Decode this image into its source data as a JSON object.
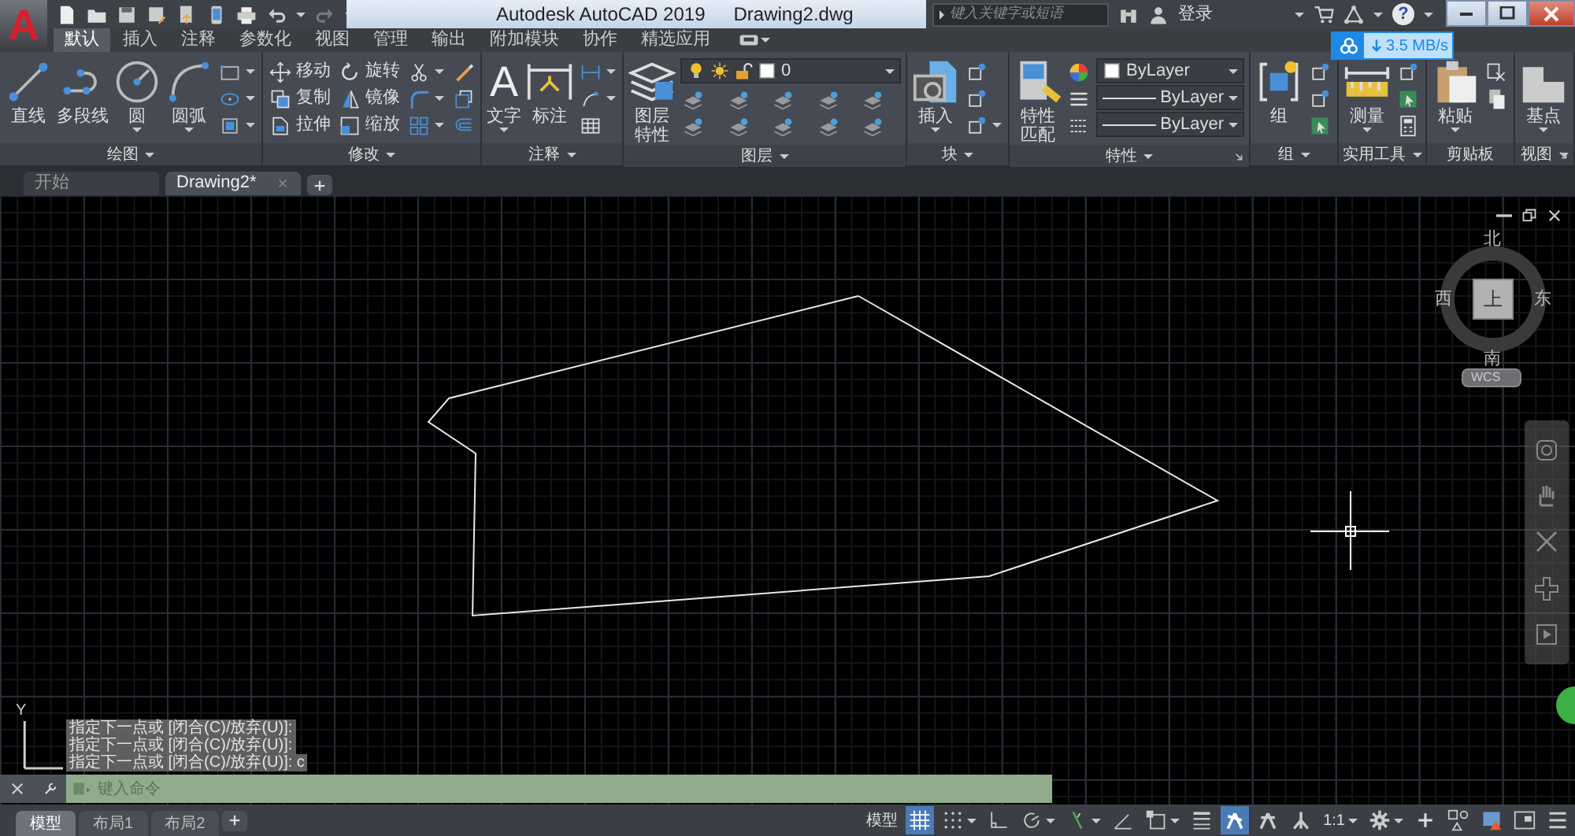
{
  "title_bar": {
    "app_glyph": "A",
    "title": "Autodesk AutoCAD 2019",
    "document": "Drawing2.dwg",
    "search_placeholder": "键入关键字或短语",
    "sign_in": "登录",
    "help_glyph": "?"
  },
  "download_widget": {
    "speed": "3.5 MB/s"
  },
  "ribbon_tabs": [
    {
      "label": "默认",
      "selected": true
    },
    {
      "label": "插入",
      "selected": false
    },
    {
      "label": "注释",
      "selected": false
    },
    {
      "label": "参数化",
      "selected": false
    },
    {
      "label": "视图",
      "selected": false
    },
    {
      "label": "管理",
      "selected": false
    },
    {
      "label": "输出",
      "selected": false
    },
    {
      "label": "附加模块",
      "selected": false
    },
    {
      "label": "协作",
      "selected": false
    },
    {
      "label": "精选应用",
      "selected": false
    }
  ],
  "panels": [
    {
      "title": "绘图",
      "menu": true,
      "launcher": false,
      "tools": [
        {
          "kind": "large",
          "label": "直线",
          "menu": false
        },
        {
          "kind": "large",
          "label": "多段线",
          "menu": false
        },
        {
          "kind": "large",
          "label": "圆",
          "menu": true
        },
        {
          "kind": "large",
          "label": "圆弧",
          "menu": true
        },
        {
          "kind": "small",
          "menu": true
        },
        {
          "kind": "small",
          "menu": true
        },
        {
          "kind": "small",
          "menu": true
        }
      ]
    },
    {
      "title": "修改",
      "menu": true,
      "launcher": false,
      "tools": [
        {
          "kind": "small",
          "label": "移动",
          "menu": false
        },
        {
          "kind": "small",
          "label": "复制",
          "menu": false
        },
        {
          "kind": "small",
          "label": "拉伸",
          "menu": false
        },
        {
          "kind": "small",
          "label": "旋转",
          "menu": false
        },
        {
          "kind": "small",
          "label": "镜像",
          "menu": false
        },
        {
          "kind": "small",
          "label": "缩放",
          "menu": false
        },
        {
          "kind": "small",
          "menu": true
        },
        {
          "kind": "small",
          "menu": true
        },
        {
          "kind": "small",
          "menu": true
        },
        {
          "kind": "small",
          "menu": false
        },
        {
          "kind": "small",
          "menu": false
        },
        {
          "kind": "small",
          "menu": false
        }
      ]
    },
    {
      "title": "注释",
      "menu": true,
      "launcher": false,
      "tools": [
        {
          "kind": "large",
          "label": "文字",
          "glyph": "A",
          "menu": true
        },
        {
          "kind": "large",
          "label": "标注",
          "menu": false
        },
        {
          "kind": "small",
          "menu": true
        },
        {
          "kind": "small",
          "menu": true
        },
        {
          "kind": "small",
          "menu": false
        }
      ]
    },
    {
      "title": "图层",
      "menu": true,
      "launcher": false,
      "tools": [
        {
          "kind": "large",
          "label": "图层特性",
          "menu": false
        },
        {
          "kind": "small",
          "menu": false
        },
        {
          "kind": "small",
          "menu": false
        },
        {
          "kind": "small",
          "menu": false
        },
        {
          "kind": "small",
          "menu": false
        },
        {
          "kind": "small",
          "menu": false
        },
        {
          "kind": "small",
          "menu": false
        },
        {
          "kind": "small",
          "menu": false
        },
        {
          "kind": "small",
          "menu": false
        },
        {
          "kind": "small",
          "menu": false
        },
        {
          "kind": "small",
          "menu": false
        }
      ],
      "dropdowns": [
        {
          "kind": "layer",
          "value": "0"
        }
      ]
    },
    {
      "title": "块",
      "menu": true,
      "launcher": false,
      "tools": [
        {
          "kind": "large",
          "label": "插入",
          "menu": true
        },
        {
          "kind": "small",
          "menu": false
        },
        {
          "kind": "small",
          "menu": false
        },
        {
          "kind": "small",
          "menu": true
        }
      ]
    },
    {
      "title": "特性",
      "menu": true,
      "launcher": true,
      "tools": [
        {
          "kind": "large",
          "label": "特性匹配",
          "menu": false
        },
        {
          "kind": "small",
          "menu": false
        },
        {
          "kind": "small",
          "menu": false
        },
        {
          "kind": "small",
          "menu": false
        }
      ],
      "dropdowns": [
        {
          "kind": "color",
          "value": "ByLayer"
        },
        {
          "kind": "linetype",
          "value": "ByLayer"
        },
        {
          "kind": "lineweight",
          "value": "ByLayer"
        }
      ]
    },
    {
      "title": "组",
      "menu": true,
      "launcher": false,
      "tools": [
        {
          "kind": "large",
          "label": "组",
          "menu": false
        },
        {
          "kind": "small",
          "menu": false
        },
        {
          "kind": "small",
          "menu": false
        },
        {
          "kind": "small",
          "menu": false
        }
      ]
    },
    {
      "title": "实用工具",
      "menu": true,
      "launcher": false,
      "tools": [
        {
          "kind": "large",
          "label": "测量",
          "menu": true
        },
        {
          "kind": "small",
          "menu": false
        },
        {
          "kind": "small",
          "menu": false
        },
        {
          "kind": "small",
          "menu": false
        }
      ]
    },
    {
      "title": "剪贴板",
      "menu": false,
      "launcher": false,
      "tools": [
        {
          "kind": "large",
          "label": "粘贴",
          "menu": true
        },
        {
          "kind": "small",
          "menu": false
        },
        {
          "kind": "small",
          "menu": false
        }
      ]
    },
    {
      "title": "视图",
      "menu": true,
      "launcher": true,
      "tools": [
        {
          "kind": "large",
          "label": "基点",
          "menu": true
        }
      ]
    }
  ],
  "doc_tabs": [
    {
      "label": "开始",
      "selected": false,
      "closable": false
    },
    {
      "label": "Drawing2*",
      "selected": true,
      "closable": true
    }
  ],
  "viewcube": {
    "top": "上",
    "north": "北",
    "south": "南",
    "east": "东",
    "west": "西",
    "ucs_menu": "WCS"
  },
  "ucs_icon": {
    "axis": "Y"
  },
  "command_history": [
    "指定下一点或 [闭合(C)/放弃(U)]:",
    "指定下一点或 [闭合(C)/放弃(U)]:",
    "指定下一点或 [闭合(C)/放弃(U)]: c"
  ],
  "command_line": {
    "placeholder": "键入命令"
  },
  "layout_tabs": [
    {
      "label": "模型",
      "selected": true
    },
    {
      "label": "布局1",
      "selected": false
    },
    {
      "label": "布局2",
      "selected": false
    }
  ],
  "status_bar": [
    {
      "kind": "text",
      "label": "模型",
      "on": false,
      "menu": false
    },
    {
      "kind": "icon",
      "on": true,
      "menu": false
    },
    {
      "kind": "icon",
      "on": false,
      "menu": true
    },
    {
      "kind": "icon",
      "on": false,
      "menu": false
    },
    {
      "kind": "icon",
      "on": false,
      "menu": true
    },
    {
      "kind": "icon",
      "on": false,
      "menu": true
    },
    {
      "kind": "icon",
      "on": false,
      "menu": false
    },
    {
      "kind": "icon",
      "on": false,
      "menu": true
    },
    {
      "kind": "icon",
      "on": false,
      "menu": false
    },
    {
      "kind": "icon",
      "on": true,
      "menu": false
    },
    {
      "kind": "icon",
      "on": false,
      "menu": false
    },
    {
      "kind": "icon",
      "on": false,
      "menu": false
    },
    {
      "kind": "text",
      "label": "1:1",
      "on": false,
      "menu": true
    },
    {
      "kind": "icon",
      "on": false,
      "menu": true
    },
    {
      "kind": "icon",
      "on": false,
      "menu": false
    },
    {
      "kind": "icon",
      "on": false,
      "menu": false
    },
    {
      "kind": "icon",
      "on": false,
      "menu": false
    },
    {
      "kind": "icon",
      "on": false,
      "menu": false
    },
    {
      "kind": "icon",
      "on": false,
      "menu": false
    }
  ]
}
